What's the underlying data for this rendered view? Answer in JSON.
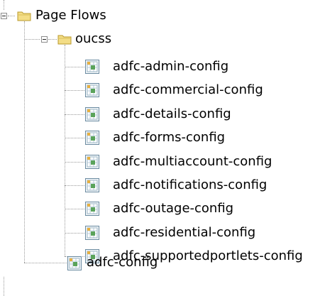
{
  "tree": {
    "root": {
      "label": "Page Flows",
      "icon": "folder-icon",
      "expanded": true
    },
    "oucss": {
      "label": "oucss",
      "icon": "folder-icon",
      "expanded": true,
      "items": [
        "adfc-admin-config",
        "adfc-commercial-config",
        "adfc-details-config",
        "adfc-forms-config",
        "adfc-multiaccount-config",
        "adfc-notifications-config",
        "adfc-outage-config",
        "adfc-residential-config",
        "adfc-supportedportlets-config"
      ]
    },
    "sibling": {
      "label": "adfc-config",
      "icon": "adfc-file-icon"
    }
  },
  "colors": {
    "folder_fill": "#f3dd86",
    "folder_edge": "#b9992c",
    "file_border": "#6a8aa0",
    "file_grid": "#5aa35a",
    "tree_line": "#9a9a9a"
  }
}
